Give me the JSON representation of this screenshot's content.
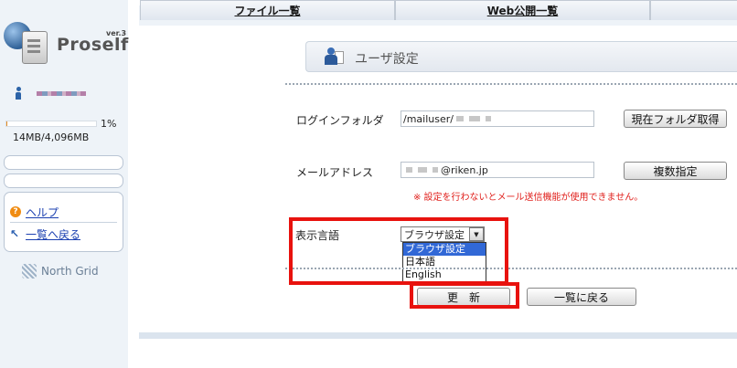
{
  "sidebar": {
    "logo": {
      "version": "ver.3",
      "name": "Proself"
    },
    "quota": {
      "percent_label": "1%",
      "percent_value": 0.01,
      "size_label": "14MB/4,096MB"
    },
    "menu": {
      "help_label": "ヘルプ",
      "back_label": "一覧へ戻る"
    },
    "footer_brand": "North Grid"
  },
  "tabs": [
    {
      "label": "ファイル一覧"
    },
    {
      "label": "Web公開一覧"
    },
    {
      "label": ""
    }
  ],
  "header": {
    "title": "ユーザ設定"
  },
  "form": {
    "login_folder": {
      "label": "ログインフォルダ",
      "value": "/mailuser/",
      "button_label": "現在フォルダ取得"
    },
    "email": {
      "label": "メールアドレス",
      "value_suffix": "@riken.jp",
      "button_label": "複数指定"
    },
    "email_note": "※ 設定を行わないとメール送信機能が使用できません。",
    "language": {
      "label": "表示言語",
      "selected": "ブラウザ設定",
      "options": [
        "ブラウザ設定",
        "日本語",
        "English"
      ]
    },
    "update_button_label": "更　新",
    "back_button_label": "一覧に戻る"
  },
  "colors": {
    "highlight": "#e8120e",
    "link": "#1a3fb0",
    "note": "#e0201c",
    "selected_option": "#3168d6"
  }
}
